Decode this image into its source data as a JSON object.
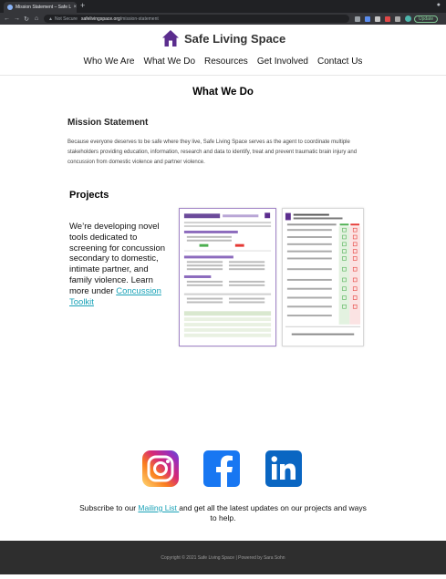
{
  "browser": {
    "tab_title": "Mission Statement – Safe Livi...",
    "tab_close": "×",
    "new_tab": "+",
    "url_warning": "Not Secure",
    "url_host": "safelivingspace.org",
    "url_path": "/mission-statement",
    "update_label": "Update",
    "back_glyph": "←",
    "forward_glyph": "→",
    "reload_glyph": "↻",
    "home_glyph": "⌂",
    "menu_glyph": "⋮"
  },
  "site": {
    "logo_text": "Safe Living Space",
    "brand_color": "#5b2d8e"
  },
  "nav": {
    "items": [
      "Who We Are",
      "What We Do",
      "Resources",
      "Get Involved",
      "Contact Us"
    ]
  },
  "page": {
    "heading": "What We Do",
    "mission_title": "Mission Statement",
    "mission_text": "Because everyone deserves to be safe where they live, Safe Living Space serves as the agent to coordinate multiple stakeholders providing education, information, research and data to identify, treat and prevent traumatic brain injury and concussion from domestic violence and partner violence.",
    "projects_title": "Projects",
    "projects_text": "We’re developing novel tools dedicated to screening for concussion secondary to domestic, intimate partner, and family violence. Learn more under ",
    "projects_link": "Concussion Toolkit"
  },
  "subscribe": {
    "prefix": "Subscribe to our ",
    "link": "Mailing List ",
    "suffix": "and get all the latest updates on our projects and ways to help."
  },
  "footer": {
    "text": "Copyright © 2021 Safe Living Space | Powered by Sara Sohn"
  },
  "icons": {
    "instagram": "instagram-icon",
    "facebook": "facebook-icon",
    "linkedin": "linkedin-icon"
  },
  "colors": {
    "link": "#19a2b7",
    "footer_bg": "#2e2e2e",
    "facebook": "#1877f2",
    "linkedin": "#0a66c2"
  }
}
